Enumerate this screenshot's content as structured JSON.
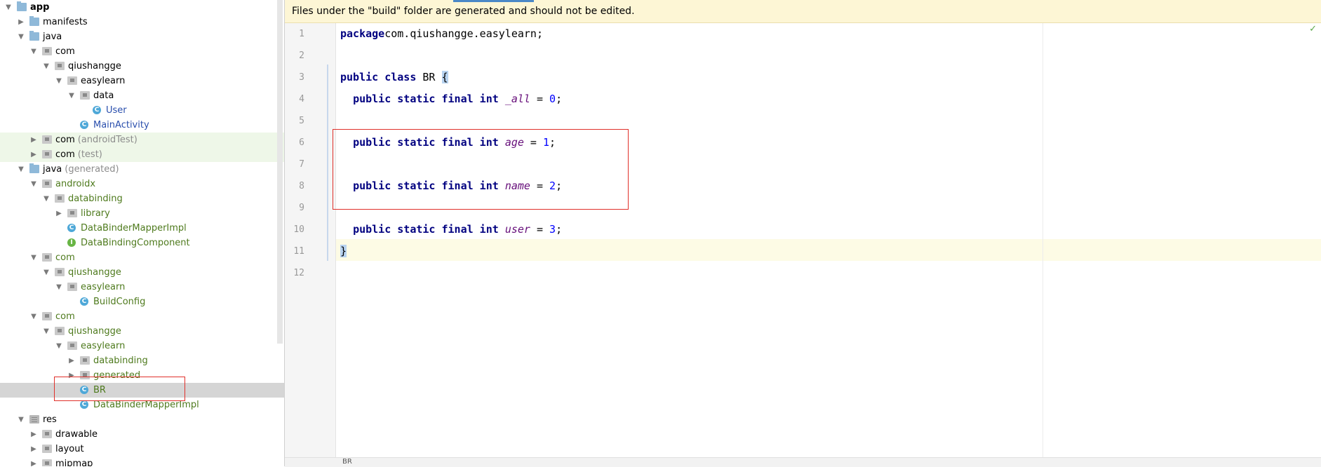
{
  "tree": {
    "rows": [
      {
        "label": "app",
        "indent": 0,
        "arrow": "down",
        "icon": "folder-blue",
        "bold": true
      },
      {
        "label": "manifests",
        "indent": 1,
        "arrow": "right",
        "icon": "folder-blue"
      },
      {
        "label": "java",
        "indent": 1,
        "arrow": "down",
        "icon": "folder-blue"
      },
      {
        "label": "com",
        "indent": 2,
        "arrow": "down",
        "icon": "pkg"
      },
      {
        "label": "qiushangge",
        "indent": 3,
        "arrow": "down",
        "icon": "pkg"
      },
      {
        "label": "easylearn",
        "indent": 4,
        "arrow": "down",
        "icon": "pkg"
      },
      {
        "label": "data",
        "indent": 5,
        "arrow": "down",
        "icon": "pkg"
      },
      {
        "label": "User",
        "indent": 6,
        "arrow": "none",
        "icon": "cls",
        "color": "blue"
      },
      {
        "label": "MainActivity",
        "indent": 5,
        "arrow": "none",
        "icon": "cls",
        "color": "blue"
      },
      {
        "label": "com",
        "suffix": "(androidTest)",
        "indent": 2,
        "arrow": "right",
        "icon": "pkg",
        "green": true
      },
      {
        "label": "com",
        "suffix": "(test)",
        "indent": 2,
        "arrow": "right",
        "icon": "pkg",
        "green": true
      },
      {
        "label": "java",
        "suffix": "(generated)",
        "indent": 1,
        "arrow": "down",
        "icon": "folder-blue"
      },
      {
        "label": "androidx",
        "indent": 2,
        "arrow": "down",
        "icon": "pkg",
        "color": "green"
      },
      {
        "label": "databinding",
        "indent": 3,
        "arrow": "down",
        "icon": "pkg",
        "color": "green"
      },
      {
        "label": "library",
        "indent": 4,
        "arrow": "right",
        "icon": "pkg",
        "color": "green"
      },
      {
        "label": "DataBinderMapperImpl",
        "indent": 4,
        "arrow": "none",
        "icon": "cls",
        "color": "green"
      },
      {
        "label": "DataBindingComponent",
        "indent": 4,
        "arrow": "none",
        "icon": "iface",
        "color": "green"
      },
      {
        "label": "com",
        "indent": 2,
        "arrow": "down",
        "icon": "pkg",
        "color": "green"
      },
      {
        "label": "qiushangge",
        "indent": 3,
        "arrow": "down",
        "icon": "pkg",
        "color": "green"
      },
      {
        "label": "easylearn",
        "indent": 4,
        "arrow": "down",
        "icon": "pkg",
        "color": "green"
      },
      {
        "label": "BuildConfig",
        "indent": 5,
        "arrow": "none",
        "icon": "cls",
        "color": "green"
      },
      {
        "label": "com",
        "indent": 2,
        "arrow": "down",
        "icon": "pkg",
        "color": "green"
      },
      {
        "label": "qiushangge",
        "indent": 3,
        "arrow": "down",
        "icon": "pkg",
        "color": "green"
      },
      {
        "label": "easylearn",
        "indent": 4,
        "arrow": "down",
        "icon": "pkg",
        "color": "green"
      },
      {
        "label": "databinding",
        "indent": 5,
        "arrow": "right",
        "icon": "pkg",
        "color": "green"
      },
      {
        "label": "generated",
        "indent": 5,
        "arrow": "right",
        "icon": "pkg",
        "color": "green"
      },
      {
        "label": "BR",
        "indent": 5,
        "arrow": "none",
        "icon": "cls",
        "color": "green",
        "selected": true
      },
      {
        "label": "DataBinderMapperImpl",
        "indent": 5,
        "arrow": "none",
        "icon": "cls",
        "color": "green"
      },
      {
        "label": "res",
        "indent": 1,
        "arrow": "down",
        "icon": "res"
      },
      {
        "label": "drawable",
        "indent": 2,
        "arrow": "right",
        "icon": "pkg"
      },
      {
        "label": "layout",
        "indent": 2,
        "arrow": "right",
        "icon": "pkg"
      },
      {
        "label": "mipmap",
        "indent": 2,
        "arrow": "right",
        "icon": "pkg"
      }
    ]
  },
  "editor": {
    "banner": "Files under the \"build\" folder are generated and should not be edited.",
    "status_label": "BR",
    "lines": [
      {
        "n": "1",
        "tokens": [
          [
            "kw",
            "package"
          ],
          [
            "",
            "com.qiushangge.easylearn;"
          ]
        ]
      },
      {
        "n": "2",
        "tokens": []
      },
      {
        "n": "3",
        "tokens": [
          [
            "kw",
            "public"
          ],
          [
            "",
            " "
          ],
          [
            "kw",
            "class"
          ],
          [
            "",
            " BR "
          ],
          [
            "brace",
            "{"
          ]
        ]
      },
      {
        "n": "4",
        "tokens": [
          [
            "",
            "  "
          ],
          [
            "kw",
            "public static final int"
          ],
          [
            "",
            " "
          ],
          [
            "fld",
            "_all"
          ],
          [
            "",
            " = "
          ],
          [
            "num",
            "0"
          ],
          [
            "",
            ";"
          ]
        ]
      },
      {
        "n": "5",
        "tokens": []
      },
      {
        "n": "6",
        "tokens": [
          [
            "",
            "  "
          ],
          [
            "kw",
            "public static final int"
          ],
          [
            "",
            " "
          ],
          [
            "fld",
            "age"
          ],
          [
            "",
            " = "
          ],
          [
            "num",
            "1"
          ],
          [
            "",
            ";"
          ]
        ]
      },
      {
        "n": "7",
        "tokens": []
      },
      {
        "n": "8",
        "tokens": [
          [
            "",
            "  "
          ],
          [
            "kw",
            "public static final int"
          ],
          [
            "",
            " "
          ],
          [
            "fld",
            "name"
          ],
          [
            "",
            " = "
          ],
          [
            "num",
            "2"
          ],
          [
            "",
            ";"
          ]
        ]
      },
      {
        "n": "9",
        "tokens": []
      },
      {
        "n": "10",
        "tokens": [
          [
            "",
            "  "
          ],
          [
            "kw",
            "public static final int"
          ],
          [
            "",
            " "
          ],
          [
            "fld",
            "user"
          ],
          [
            "",
            " = "
          ],
          [
            "num",
            "3"
          ],
          [
            "",
            ";"
          ]
        ]
      },
      {
        "n": "11",
        "tokens": [
          [
            "brace",
            "}"
          ]
        ]
      },
      {
        "n": "12",
        "tokens": []
      }
    ]
  },
  "colors": {
    "accent_red": "#e0302a",
    "keyword": "#000080",
    "field": "#660e7a",
    "number": "#0000ff",
    "generated_green": "#4e7a1d"
  }
}
